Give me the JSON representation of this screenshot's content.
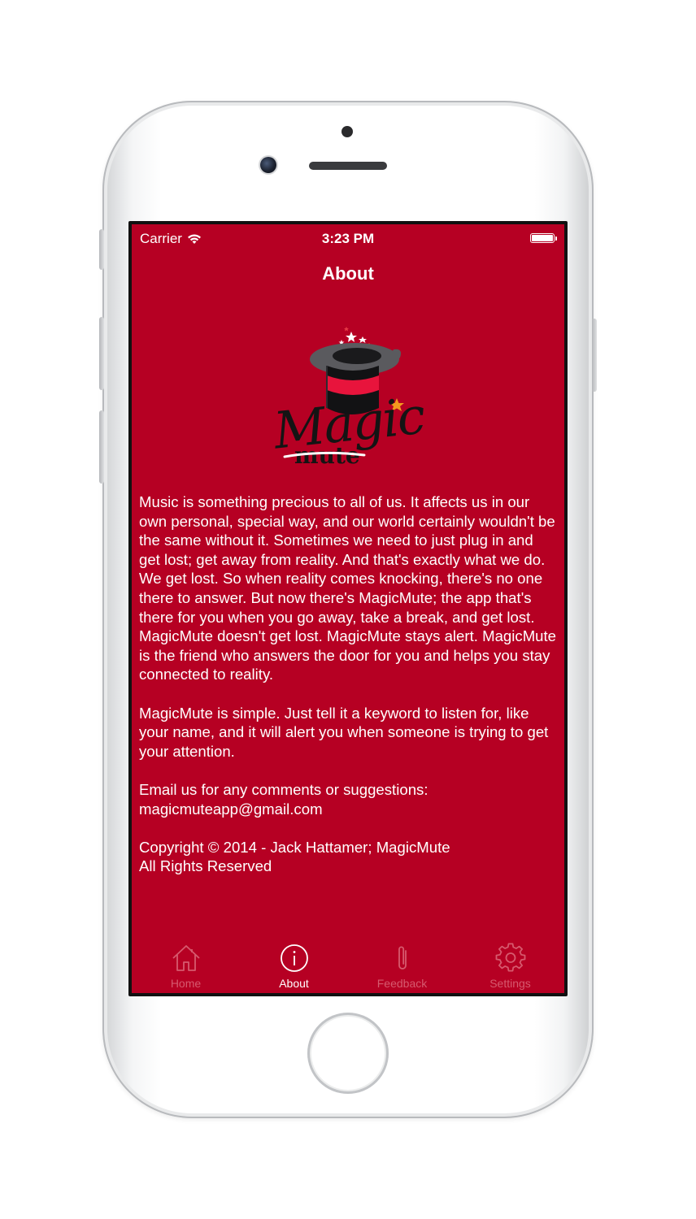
{
  "status_bar": {
    "carrier": "Carrier",
    "time": "3:23 PM",
    "wifi_icon": "wifi-icon",
    "battery_icon": "battery-full-icon"
  },
  "nav": {
    "title": "About"
  },
  "logo": {
    "main_text": "Magic",
    "sub_text": "mute"
  },
  "about": {
    "paragraphs": [
      "Music is something precious to all of us. It affects us in our own personal, special way, and our world certainly wouldn't be the same without it. Sometimes we need to just plug in and get lost; get away from reality. And that's exactly what we do. We get lost. So when reality comes knocking, there's no one there to answer. But now there's MagicMute; the app that's there for you when you go away, take a break, and get lost. MagicMute doesn't get lost. MagicMute stays alert. MagicMute is the friend who answers the door for you and helps you stay connected to reality.",
      "MagicMute is simple. Just tell it a keyword to listen for, like your name, and it will alert you when someone is trying to get your attention."
    ],
    "email_prompt": "Email us for any comments or suggestions:",
    "email": "magicmuteapp@gmail.com",
    "copyright": "Copyright © 2014 - Jack Hattamer; MagicMute",
    "rights": "All Rights Reserved"
  },
  "tabs": [
    {
      "label": "Home",
      "icon": "home-icon",
      "active": false
    },
    {
      "label": "About",
      "icon": "info-icon",
      "active": true
    },
    {
      "label": "Feedback",
      "icon": "paperclip-icon",
      "active": false
    },
    {
      "label": "Settings",
      "icon": "gear-icon",
      "active": false
    }
  ],
  "colors": {
    "app_background": "#b60023",
    "text": "#ffffff",
    "inactive_tab": "#d65a6e"
  }
}
